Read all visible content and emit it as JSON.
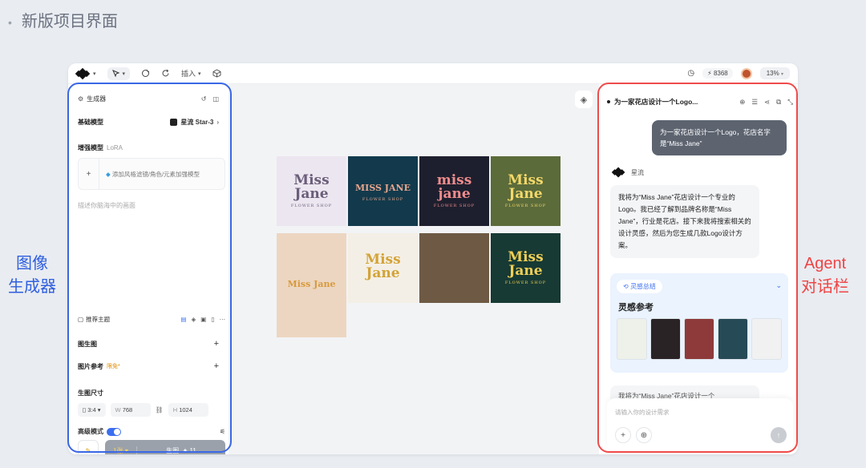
{
  "slide": {
    "bullet": "•",
    "title": "新版项目界面"
  },
  "labels": {
    "left_line1": "图像",
    "left_line2": "生成器",
    "right_line1": "Agent",
    "right_line2": "对话栏"
  },
  "topbar": {
    "insert_label": "插入",
    "credits": "8368",
    "zoom": "13%"
  },
  "generator": {
    "title": "生成器",
    "base_model_label": "基础模型",
    "base_model_value": "星流 Star-3",
    "lora_label": "增强模型",
    "lora_tag": "LoRA",
    "lora_add_text": "添加风格滤镜/角色/元素加强模型",
    "prompt_placeholder": "描述你脑海中的画面",
    "theme_label": "推荐主题",
    "img2img_label": "图生图",
    "ref_label": "图片参考",
    "ref_badge": "限免*",
    "size_label": "生图尺寸",
    "ratio": "3:4",
    "width_prefix": "W",
    "width": "768",
    "height_prefix": "H",
    "height": "1024",
    "advanced_label": "高级模式",
    "count": "1张",
    "generate_label": "生图",
    "cost": "11"
  },
  "canvas": {
    "tiles": [
      {
        "line1": "Miss",
        "line2": "Jane",
        "sub": "FLOWER SHOP",
        "bg": "#ece6f0",
        "fg": "#6b5e7a"
      },
      {
        "line1": "MISS JANE",
        "line2": "",
        "sub": "FLOWER SHOP",
        "bg": "#123a4c",
        "fg": "#e8a58d"
      },
      {
        "line1": "miss",
        "line2": "jane",
        "sub": "FLOWER SHOP",
        "bg": "#1e1f2e",
        "fg": "#ef8c8c"
      },
      {
        "line1": "Miss",
        "line2": "Jane",
        "sub": "FLOWER SHOP",
        "bg": "#5b6b3a",
        "fg": "#f3d86a"
      },
      {
        "line1": "Miss Jane",
        "line2": "",
        "sub": "",
        "bg": "#ecd6c1",
        "fg": "#d89a3c"
      },
      {
        "line1": "Miss",
        "line2": "Jane",
        "sub": "",
        "bg": "#f4efe6",
        "fg": "#d3a337"
      },
      {
        "line1": "",
        "line2": "",
        "sub": "",
        "bg": "#6e5a44",
        "fg": "#c79a64"
      },
      {
        "line1": "Miss",
        "line2": "Jane",
        "sub": "FLOWER SHOP",
        "bg": "#173a34",
        "fg": "#f1cf55"
      }
    ]
  },
  "agent": {
    "title": "为一家花店设计一个Logo...",
    "user_message": "为一家花店设计一个Logo，花店名字是“Miss Jane”",
    "bot_name": "星流",
    "bot_message": "我将为“Miss Jane”花店设计一个专业的Logo。我已经了解到品牌名称是“Miss Jane”，行业是花店。接下来我将搜索相关的设计灵感，然后为您生成几款Logo设计方案。",
    "summary_tag": "灵感总结",
    "summary_title": "灵感参考",
    "bot_message2": "我将为“Miss Jane”花店设计一个",
    "input_placeholder": "请输入你的设计需求",
    "thumb_colors": [
      "#eef0ea",
      "#2a2326",
      "#8e3a3a",
      "#264a56",
      "#f1f1f1"
    ]
  }
}
